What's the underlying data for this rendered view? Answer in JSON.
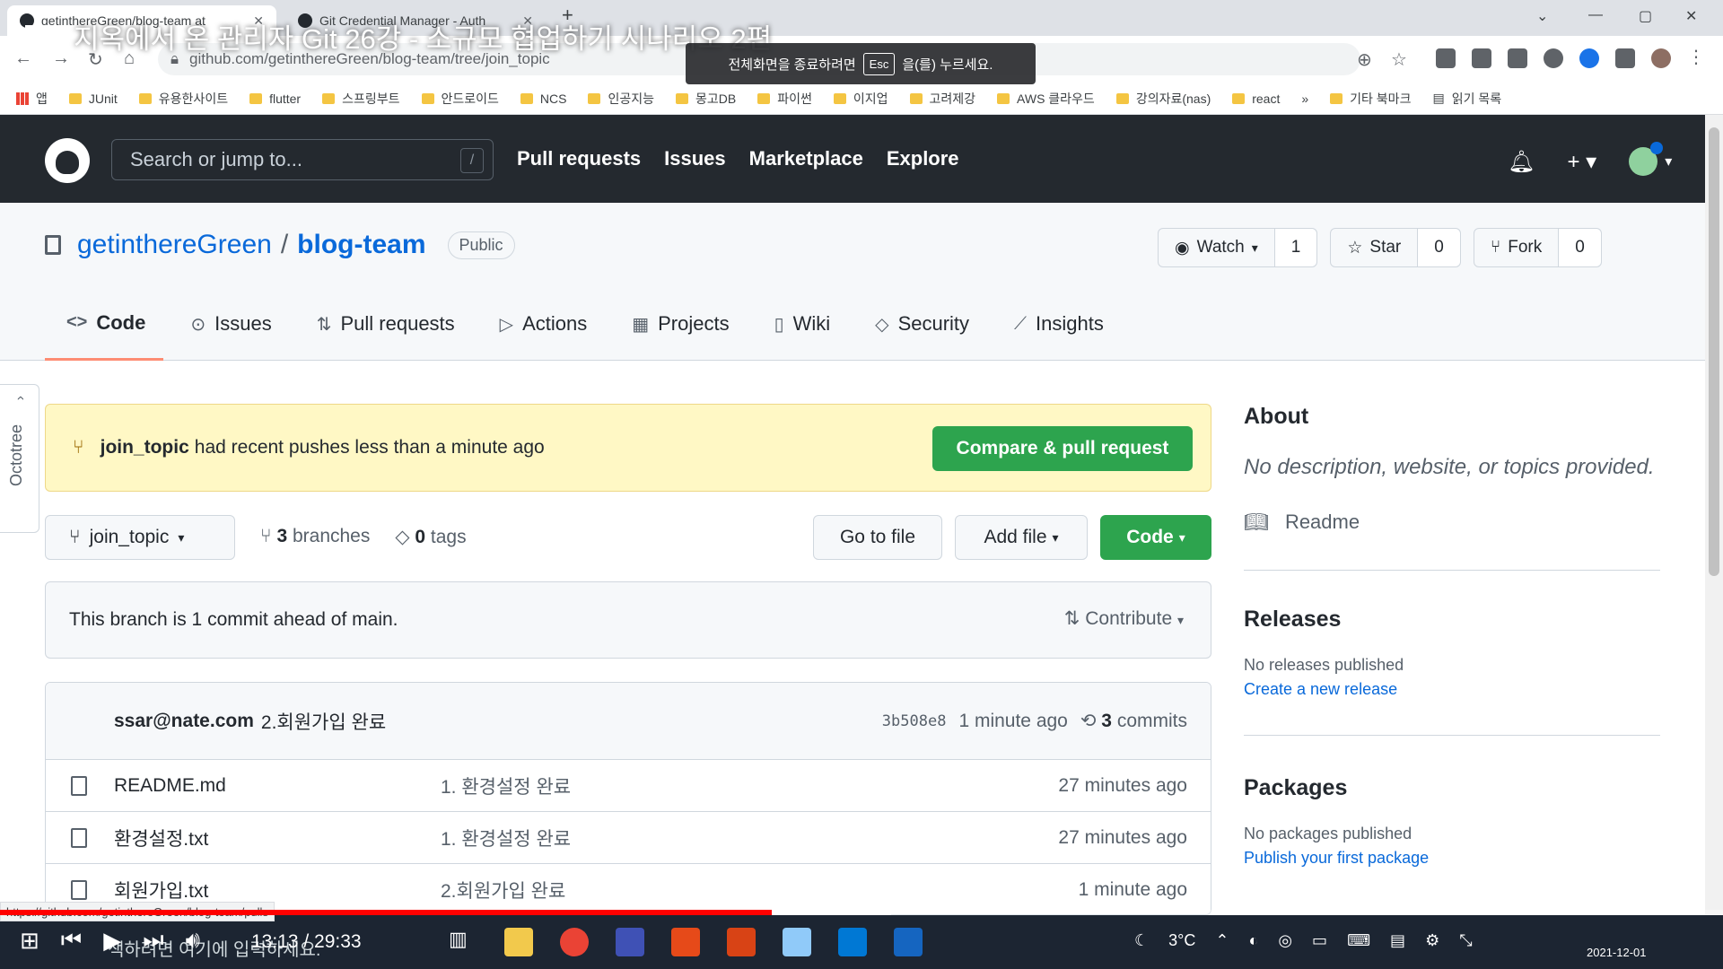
{
  "browser": {
    "tabs": [
      {
        "title": "getinthereGreen/blog-team at",
        "active": true
      },
      {
        "title": "Git Credential Manager - Auth",
        "active": false
      }
    ],
    "url": "github.com/getinthereGreen/blog-team/tree/join_topic",
    "bookmarks": [
      "앱",
      "JUnit",
      "유용한사이트",
      "flutter",
      "스프링부트",
      "안드로이드",
      "NCS",
      "인공지능",
      "몽고DB",
      "파이썬",
      "이지업",
      "고려제강",
      "AWS 클라우드",
      "강의자료(nas)",
      "react",
      "»",
      "기타 북마크",
      "읽기 목록"
    ],
    "status_url": "https://github.com/getinthereGreen/blog-team/pulls"
  },
  "video": {
    "title": "지옥에서 온 관리자 Git 26강 - 소규모 협업하기 시나리오 2편",
    "esc_toast": {
      "before": "전체화면을 종료하려면",
      "key": "Esc",
      "after": "을(를) 누르세요."
    },
    "time": "13:13 / 29:33",
    "progress": 0.448,
    "buffered": 0.517,
    "overlay_text": "색하려면 여기에 입력하세요."
  },
  "github": {
    "search_placeholder": "Search or jump to...",
    "search_key": "/",
    "nav": [
      "Pull requests",
      "Issues",
      "Marketplace",
      "Explore"
    ]
  },
  "repo": {
    "owner": "getinthereGreen",
    "separator": "/",
    "name": "blog-team",
    "visibility": "Public",
    "watch": {
      "label": "Watch",
      "count": "1"
    },
    "star": {
      "label": "Star",
      "count": "0"
    },
    "fork": {
      "label": "Fork",
      "count": "0"
    },
    "tabs": [
      {
        "icon": "code-icon",
        "glyph": "<>",
        "label": "Code"
      },
      {
        "icon": "issue-icon",
        "glyph": "⊙",
        "label": "Issues"
      },
      {
        "icon": "pull-request-icon",
        "glyph": "⇅",
        "label": "Pull requests"
      },
      {
        "icon": "play-icon",
        "glyph": "▷",
        "label": "Actions"
      },
      {
        "icon": "project-icon",
        "glyph": "▦",
        "label": "Projects"
      },
      {
        "icon": "book-icon",
        "glyph": "▯",
        "label": "Wiki"
      },
      {
        "icon": "shield-icon",
        "glyph": "◇",
        "label": "Security"
      },
      {
        "icon": "graph-icon",
        "glyph": "⟋",
        "label": "Insights"
      }
    ]
  },
  "flash": {
    "branch": "join_topic",
    "message": "had recent pushes less than a minute ago",
    "button": "Compare & pull request"
  },
  "branchbar": {
    "current": "join_topic",
    "branches_count": "3",
    "branches_label": "branches",
    "tags_count": "0",
    "tags_label": "tags",
    "go_to_file": "Go to file",
    "add_file": "Add file",
    "code": "Code"
  },
  "ahead": {
    "message": "This branch is 1 commit ahead of main.",
    "contribute": "Contribute"
  },
  "latest_commit": {
    "author": "ssar@nate.com",
    "message": "2.회원가입 완료",
    "sha": "3b508e8",
    "age": "1 minute ago",
    "commits_count": "3",
    "commits_label": "commits"
  },
  "files": [
    {
      "name": "README.md",
      "message": "1. 환경설정 완료",
      "age": "27 minutes ago"
    },
    {
      "name": "환경설정.txt",
      "message": "1. 환경설정 완료",
      "age": "27 minutes ago"
    },
    {
      "name": "회원가입.txt",
      "message": "2.회원가입 완료",
      "age": "1 minute ago"
    }
  ],
  "sidebar": {
    "about": "About",
    "description": "No description, website, or topics provided.",
    "readme": "Readme",
    "releases": "Releases",
    "no_releases": "No releases published",
    "create_release": "Create a new release",
    "packages": "Packages",
    "no_packages": "No packages published",
    "publish_package": "Publish your first package"
  },
  "octotree": "Octotree",
  "taskbar": {
    "weather": "3°C",
    "date": "2021-12-01"
  },
  "colors": {
    "github_header": "#24292f",
    "primary_button": "#2da44e",
    "link": "#0969da",
    "flash": "#fff8c5",
    "progress": "#ff0000"
  }
}
